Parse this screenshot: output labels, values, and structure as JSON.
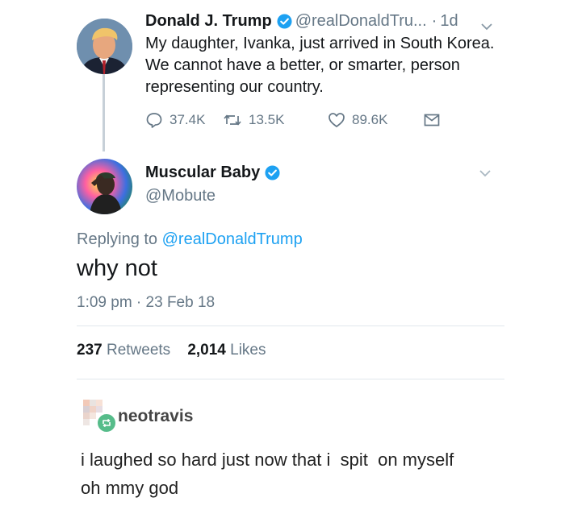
{
  "original_tweet": {
    "author_name": "Donald J. Trump",
    "handle": "@realDonaldTru...",
    "separator": "·",
    "age": "1d",
    "text": "My daughter, Ivanka, just arrived in South Korea. We cannot have a better, or smarter, person representing our country.",
    "replies": "37.4K",
    "retweets": "13.5K",
    "likes": "89.6K"
  },
  "reply_tweet": {
    "author_name": "Muscular Baby",
    "handle": "@Mobute",
    "replying_prefix": "Replying to",
    "replying_to": "@realDonaldTrump",
    "text": "why not",
    "timestamp": "1:09 pm · 23 Feb 18",
    "retweet_count": "237",
    "retweet_label": "Retweets",
    "like_count": "2,014",
    "like_label": "Likes"
  },
  "tumblr_comment": {
    "username": "neotravis",
    "lines": [
      "i laughed so hard just now that i  spit  on myself",
      "oh mmy god"
    ]
  },
  "colors": {
    "twitter_blue": "#1da1f2",
    "muted_gray": "#657786",
    "text_dark": "#14171a",
    "reblog_green": "#56bc8a"
  },
  "icons": {
    "verified": "verified-badge-icon",
    "reply": "reply-icon",
    "retweet": "retweet-icon",
    "like": "heart-icon",
    "dm": "envelope-icon",
    "menu": "chevron-down-icon",
    "reblog": "reblog-icon"
  }
}
